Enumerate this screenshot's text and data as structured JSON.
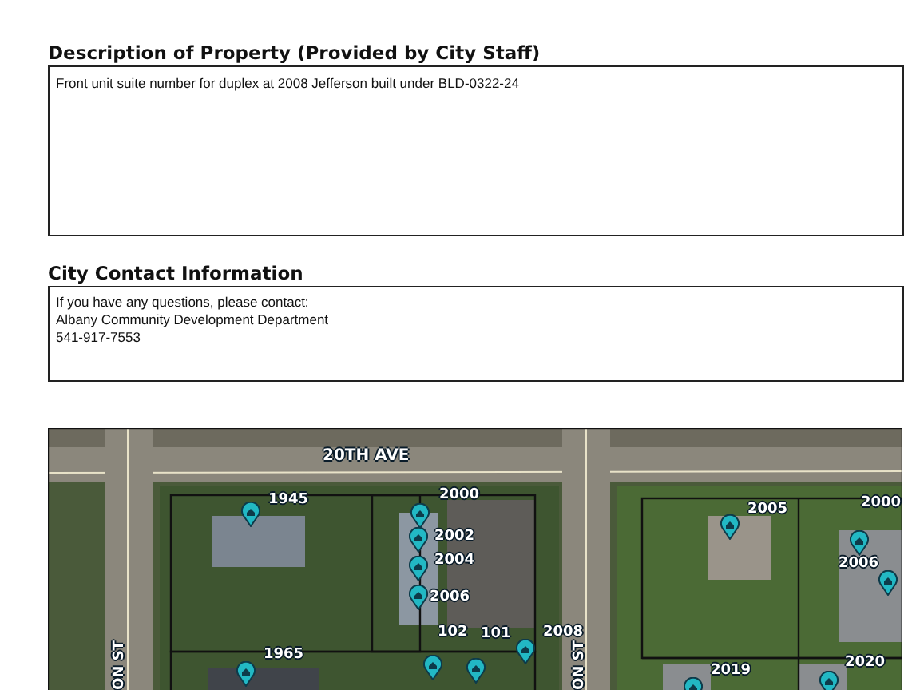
{
  "description": {
    "heading": "Description of Property (Provided by City Staff)",
    "text": "Front unit suite number for duplex at 2008 Jefferson built under BLD-0322-24"
  },
  "contact": {
    "heading": "City Contact Information",
    "lines": [
      "If you have any questions, please contact:",
      "Albany Community Development Department",
      "541-917-7553"
    ]
  },
  "map": {
    "street_labels": [
      {
        "text": "20TH AVE",
        "kind": "horizontal"
      },
      {
        "text": "ON ST",
        "kind": "vertical"
      },
      {
        "text": "ON ST",
        "kind": "vertical"
      }
    ],
    "address_labels": [
      "1945",
      "2000",
      "2002",
      "2004",
      "2006",
      "102",
      "101",
      "2008",
      "2005",
      "2000",
      "2006",
      "1965",
      "2019",
      "2020"
    ]
  }
}
